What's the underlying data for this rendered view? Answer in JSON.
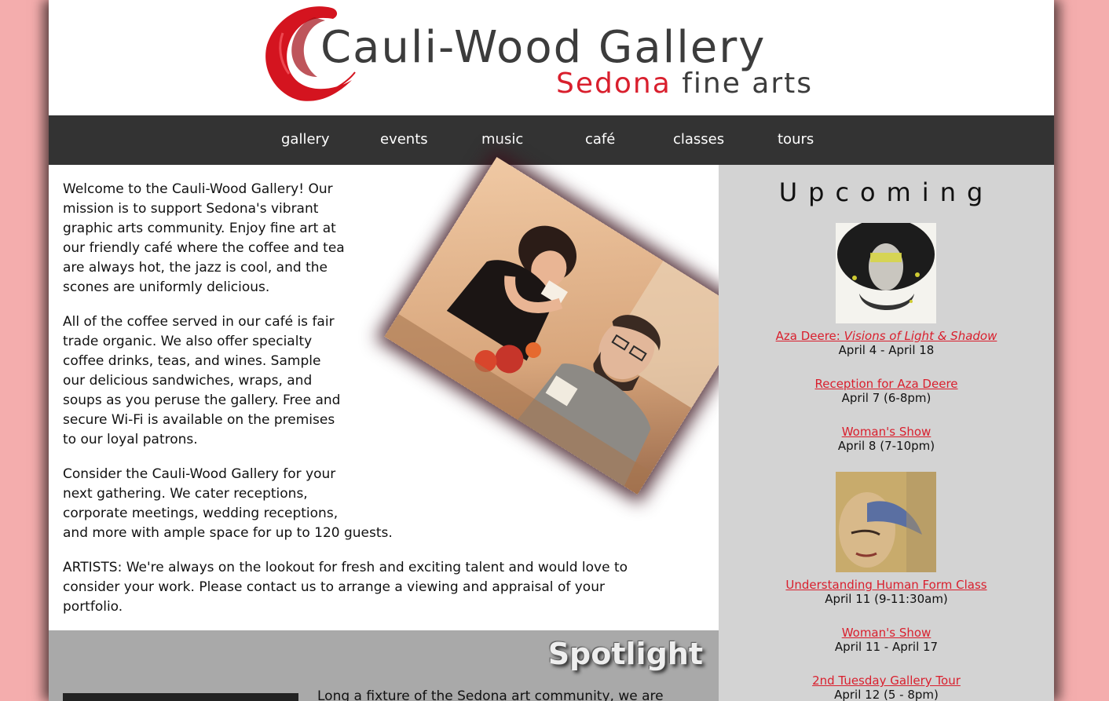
{
  "header": {
    "logo_title": "Cauli-Wood Gallery",
    "logo_sub_red": "Sedona",
    "logo_sub_grey": "fine arts"
  },
  "nav": {
    "items": [
      "gallery",
      "events",
      "music",
      "café",
      "classes",
      "tours"
    ]
  },
  "main": {
    "paragraphs": [
      [
        "Welcome to the Cauli-Wood Gallery! Our",
        "mission is to support Sedona's vibrant",
        "graphic arts community. Enjoy fine art at",
        "our friendly café where the coffee and tea",
        "are always hot, the jazz is cool, and the",
        "scones are uniformly delicious."
      ],
      [
        "All of the coffee served in our café is fair",
        "trade organic. We also offer specialty",
        "coffee drinks, teas, and wines. Sample",
        "our delicious sandwiches, wraps, and",
        "soups as you peruse the gallery. Free and",
        "secure Wi-Fi is available on the premises",
        "to our loyal patrons."
      ],
      [
        "Consider the Cauli-Wood Gallery for your",
        "next gathering. We cater receptions,",
        "corporate meetings, wedding receptions,",
        "and more with ample space for up to 120 guests."
      ],
      [
        "ARTISTS: We're always on the lookout for fresh and exciting talent and would love to",
        "consider your work. Please contact us to arrange a viewing and appraisal of your",
        "portfolio."
      ]
    ]
  },
  "spotlight": {
    "title": "Spotlight",
    "text": "Long a fixture of the Sedona art community, we are"
  },
  "sidebar": {
    "title": "Upcoming",
    "events": [
      {
        "link_prefix": "Aza Deere: ",
        "link_italic": "Visions of Light & Shadow",
        "date": "April 4 - April 18"
      },
      {
        "link": "Reception for Aza Deere",
        "date": "April 7 (6-8pm)"
      },
      {
        "link": "Woman's Show",
        "date": "April 8 (7-10pm)"
      },
      {
        "link": "Understanding Human Form Class",
        "date": "April 11 (9-11:30am)"
      },
      {
        "link": "Woman's Show",
        "date": "April 11 - April 17"
      },
      {
        "link": "2nd Tuesday Gallery Tour",
        "date": "April 12 (5 - 8pm)"
      }
    ]
  },
  "colors": {
    "accent": "#d91f2d",
    "background": "#f4adad",
    "nav": "#333333",
    "sidebar": "#d3d3d3",
    "spotlight": "#a9a9a9"
  }
}
